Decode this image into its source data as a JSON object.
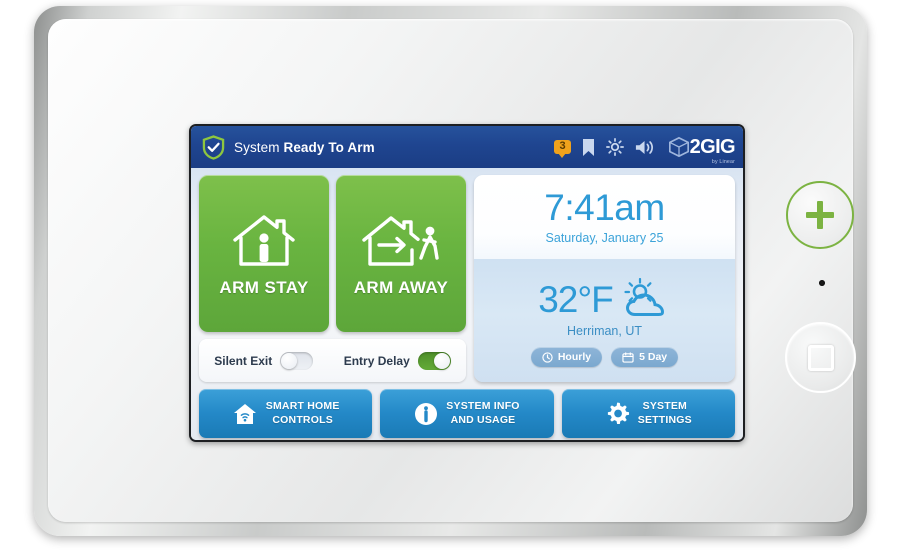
{
  "device": {
    "panic_button": "+",
    "panic_icon": "plus-icon",
    "home_icon": "square-icon",
    "led": "status-led"
  },
  "status_bar": {
    "shield_icon": "shield-check-icon",
    "status_prefix": "System ",
    "status_emphasis": "Ready To Arm",
    "message_count": "3",
    "icons": [
      "message-badge-icon",
      "bookmark-icon",
      "brightness-icon",
      "speaker-icon"
    ],
    "logo_text": "2GIG",
    "logo_subtitle": "by Linear",
    "logo_icon": "cube-icon"
  },
  "arm_buttons": [
    {
      "label": "ARM STAY",
      "icon": "house-person-icon"
    },
    {
      "label": "ARM AWAY",
      "icon": "house-exit-icon"
    }
  ],
  "toggles": [
    {
      "label": "Silent Exit",
      "state": "off"
    },
    {
      "label": "Entry Delay",
      "state": "on"
    }
  ],
  "clock": {
    "time": "7:41am",
    "date": "Saturday, January 25"
  },
  "weather": {
    "temperature": "32°F",
    "condition_icon": "partly-cloudy-icon",
    "location": "Herriman, UT",
    "buttons": [
      {
        "label": "Hourly",
        "icon": "clock-icon"
      },
      {
        "label": "5 Day",
        "icon": "calendar-icon"
      }
    ]
  },
  "bottom_nav": [
    {
      "line1": "SMART HOME",
      "line2": "CONTROLS",
      "icon": "house-wifi-icon"
    },
    {
      "line1": "SYSTEM INFO",
      "line2": "AND USAGE",
      "icon": "info-icon"
    },
    {
      "line1": "SYSTEM",
      "line2": "SETTINGS",
      "icon": "gear-icon"
    }
  ],
  "colors": {
    "header_blue": "#1f4590",
    "arm_green": "#69b440",
    "nav_blue": "#2489c8",
    "accent_cyan": "#2e9ad6",
    "badge_orange": "#f0a21c",
    "panic_green": "#7cb342"
  }
}
